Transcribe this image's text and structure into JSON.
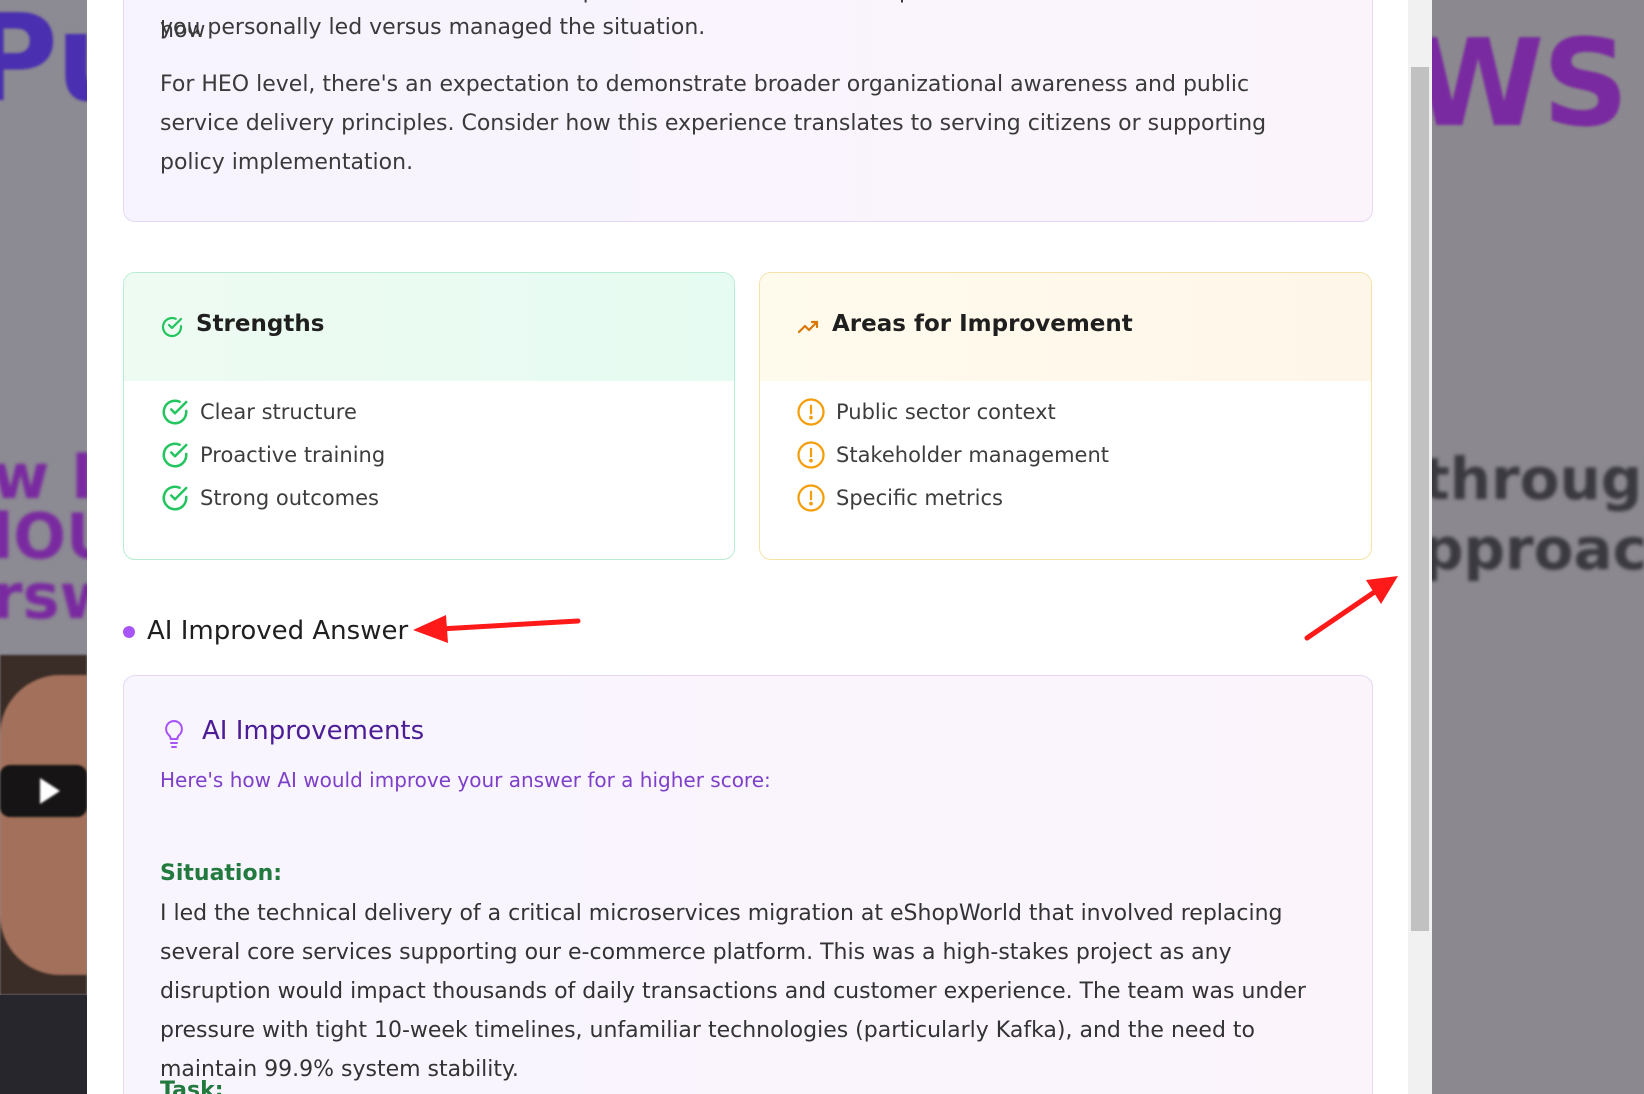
{
  "background": {
    "big_left": "Pu",
    "big_right": "WS",
    "mid_left_lines": [
      "w I",
      "lOU",
      "rsw"
    ],
    "right_lines": [
      "through a",
      "pproach"
    ]
  },
  "feedback": {
    "partial_line": "answer could also benefit from more specific metrics around team performance and clearer evidence of how",
    "line_2": "you personally led versus managed the situation.",
    "paragraph_2": "For HEO level, there's an expectation to demonstrate broader organizational awareness and public service delivery principles. Consider how this experience translates to serving citizens or supporting policy implementation."
  },
  "strengths": {
    "title": "Strengths",
    "items": [
      "Clear structure",
      "Proactive training",
      "Strong outcomes"
    ]
  },
  "improvements": {
    "title": "Areas for Improvement",
    "items": [
      "Public sector context",
      "Stakeholder management",
      "Specific metrics"
    ]
  },
  "ai_section": {
    "heading": "AI Improved Answer",
    "card_title": "AI Improvements",
    "card_subtitle": "Here's how AI would improve your answer for a higher score:",
    "situation_label": "Situation:",
    "situation_text": "I led the technical delivery of a critical microservices migration at eShopWorld that involved replacing several core services supporting our e-commerce platform. This was a high-stakes project as any disruption would impact thousands of daily transactions and customer experience. The team was under pressure with tight 10-week timelines, unfamiliar technologies (particularly Kafka), and the need to maintain 99.9% system stability.",
    "task_label": "Task:"
  },
  "colors": {
    "accent_purple": "#a855f7",
    "green": "#22c55e",
    "amber": "#f59e0b",
    "annotation_red": "#ff1a1a"
  },
  "icons": {
    "strengths_header": "check-circle-icon",
    "improvement_header": "trending-up-icon",
    "strength_item": "check-circle-icon",
    "improvement_item": "alert-circle-icon",
    "ai_card": "lightbulb-icon"
  }
}
